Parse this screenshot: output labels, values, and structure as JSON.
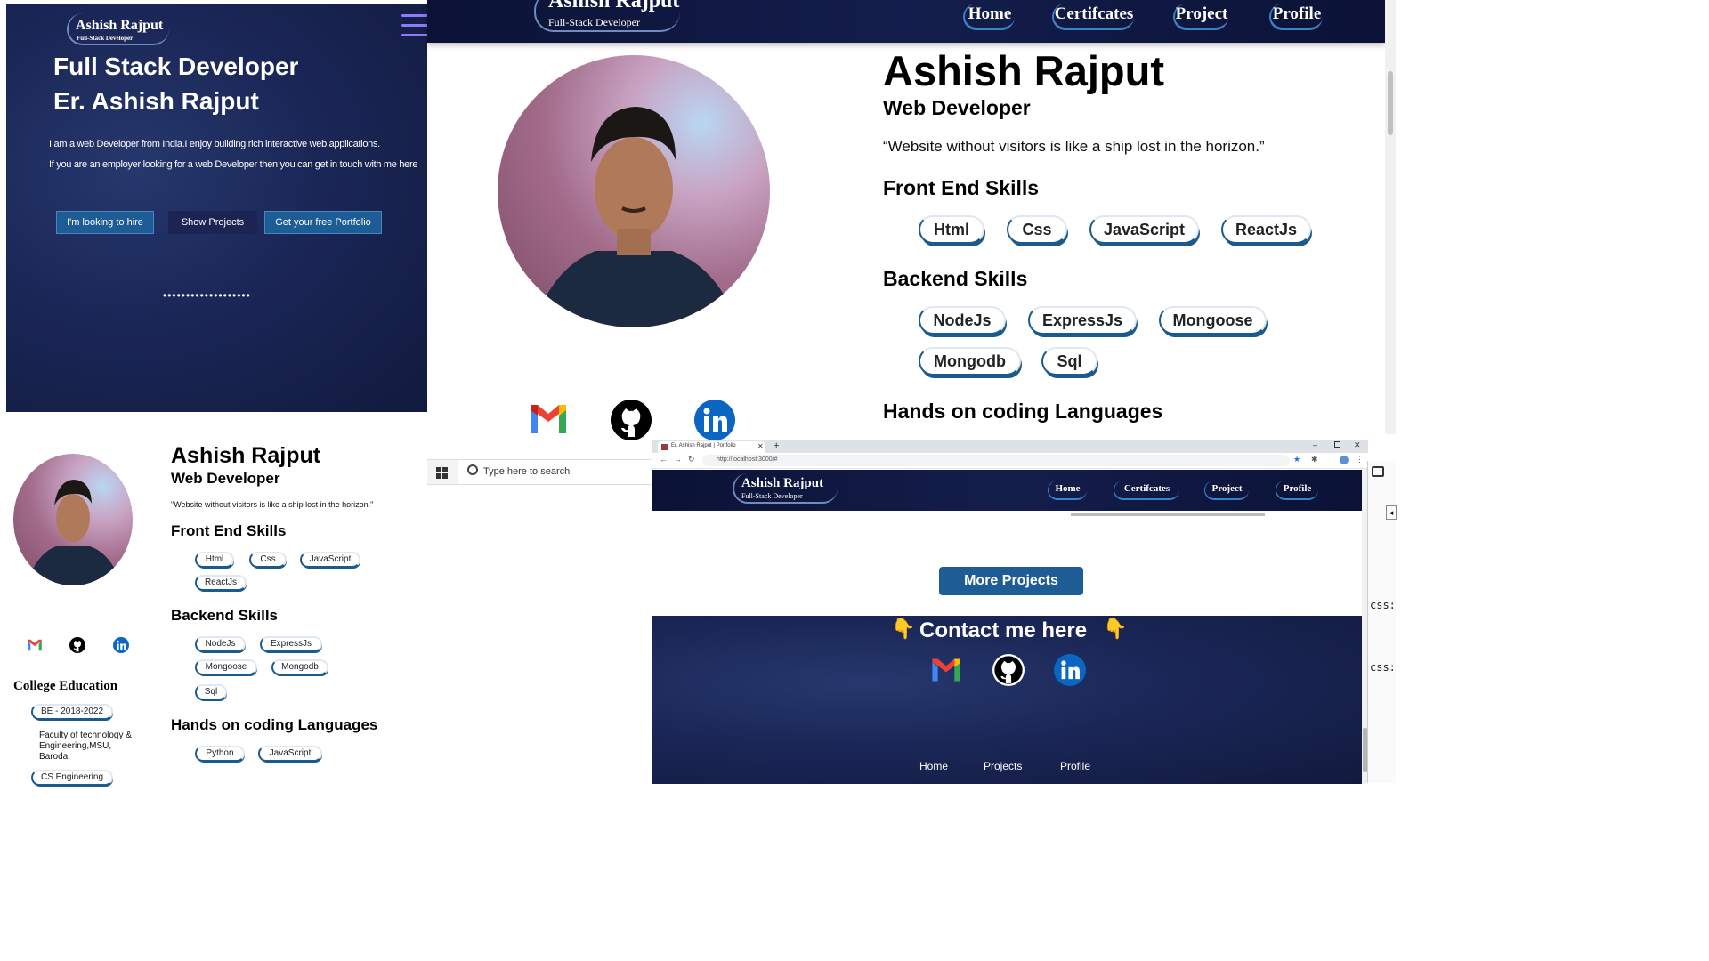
{
  "mobile_hero": {
    "brand_name": "Ashish Rajput",
    "brand_sub": "Full-Stack Developer",
    "title_line1": "Full Stack Developer",
    "title_line2": "Er. Ashish Rajput",
    "intro_line1": "I am a web Developer from India.I enjoy building rich interactive web applications.",
    "intro_line2": "If you are an employer looking for a web Developer then you can get in touch with me here",
    "btn_hire": "I'm looking to hire",
    "btn_projects": "Show Projects",
    "btn_portfolio": "Get your free Portfolio",
    "dots": "•••••••••••••••••••"
  },
  "desktop_nav": {
    "brand_name": "Ashish Rajput",
    "brand_sub": "Full-Stack Developer",
    "links": [
      "Home",
      "Certifcates",
      "Project",
      "Profile"
    ]
  },
  "profile": {
    "name": "Ashish Rajput",
    "role": "Web Developer",
    "quote": "“Website without visitors is like a ship lost in the horizon.”",
    "frontend_title": "Front End Skills",
    "frontend": [
      "Html",
      "Css",
      "JavaScript",
      "ReactJs"
    ],
    "backend_title": "Backend Skills",
    "backend": [
      "NodeJs",
      "ExpressJs",
      "Mongoose",
      "Mongodb",
      "Sql"
    ],
    "languages_title": "Hands on coding Languages",
    "languages": [
      "Python",
      "JavaScript"
    ]
  },
  "mobile_profile": {
    "name": "Ashish Rajput",
    "role": "Web Developer",
    "quote": "\"Website without visitors is like a ship lost in the horizon.\"",
    "education_title": "College Education",
    "edu_years": "BE - 2018-2022",
    "edu_college": "Faculty of technology & Engineering,MSU, Baroda",
    "edu_branch": "CS Engineering"
  },
  "taskbar": {
    "search_placeholder": "Type here to search"
  },
  "browser": {
    "tab_title": "Er. Ashish Rajput | Portfolio",
    "url": "http://localhost:3000/#",
    "brand_name": "Ashish Rajput",
    "brand_sub": "Full-Stack Developer",
    "links": [
      "Home",
      "Certifcates",
      "Project",
      "Profile"
    ],
    "more_projects": "More Projects",
    "contact_title": "Contact me here",
    "pointer_emoji": "👇",
    "footer_links": [
      "Home",
      "Projects",
      "Profile"
    ]
  },
  "side_panel": {
    "code1": "css:",
    "code2": "css:"
  },
  "colors": {
    "navy": "#1a2656",
    "accent_blue": "#1e5c96",
    "pill_border": "#3a83c9"
  }
}
